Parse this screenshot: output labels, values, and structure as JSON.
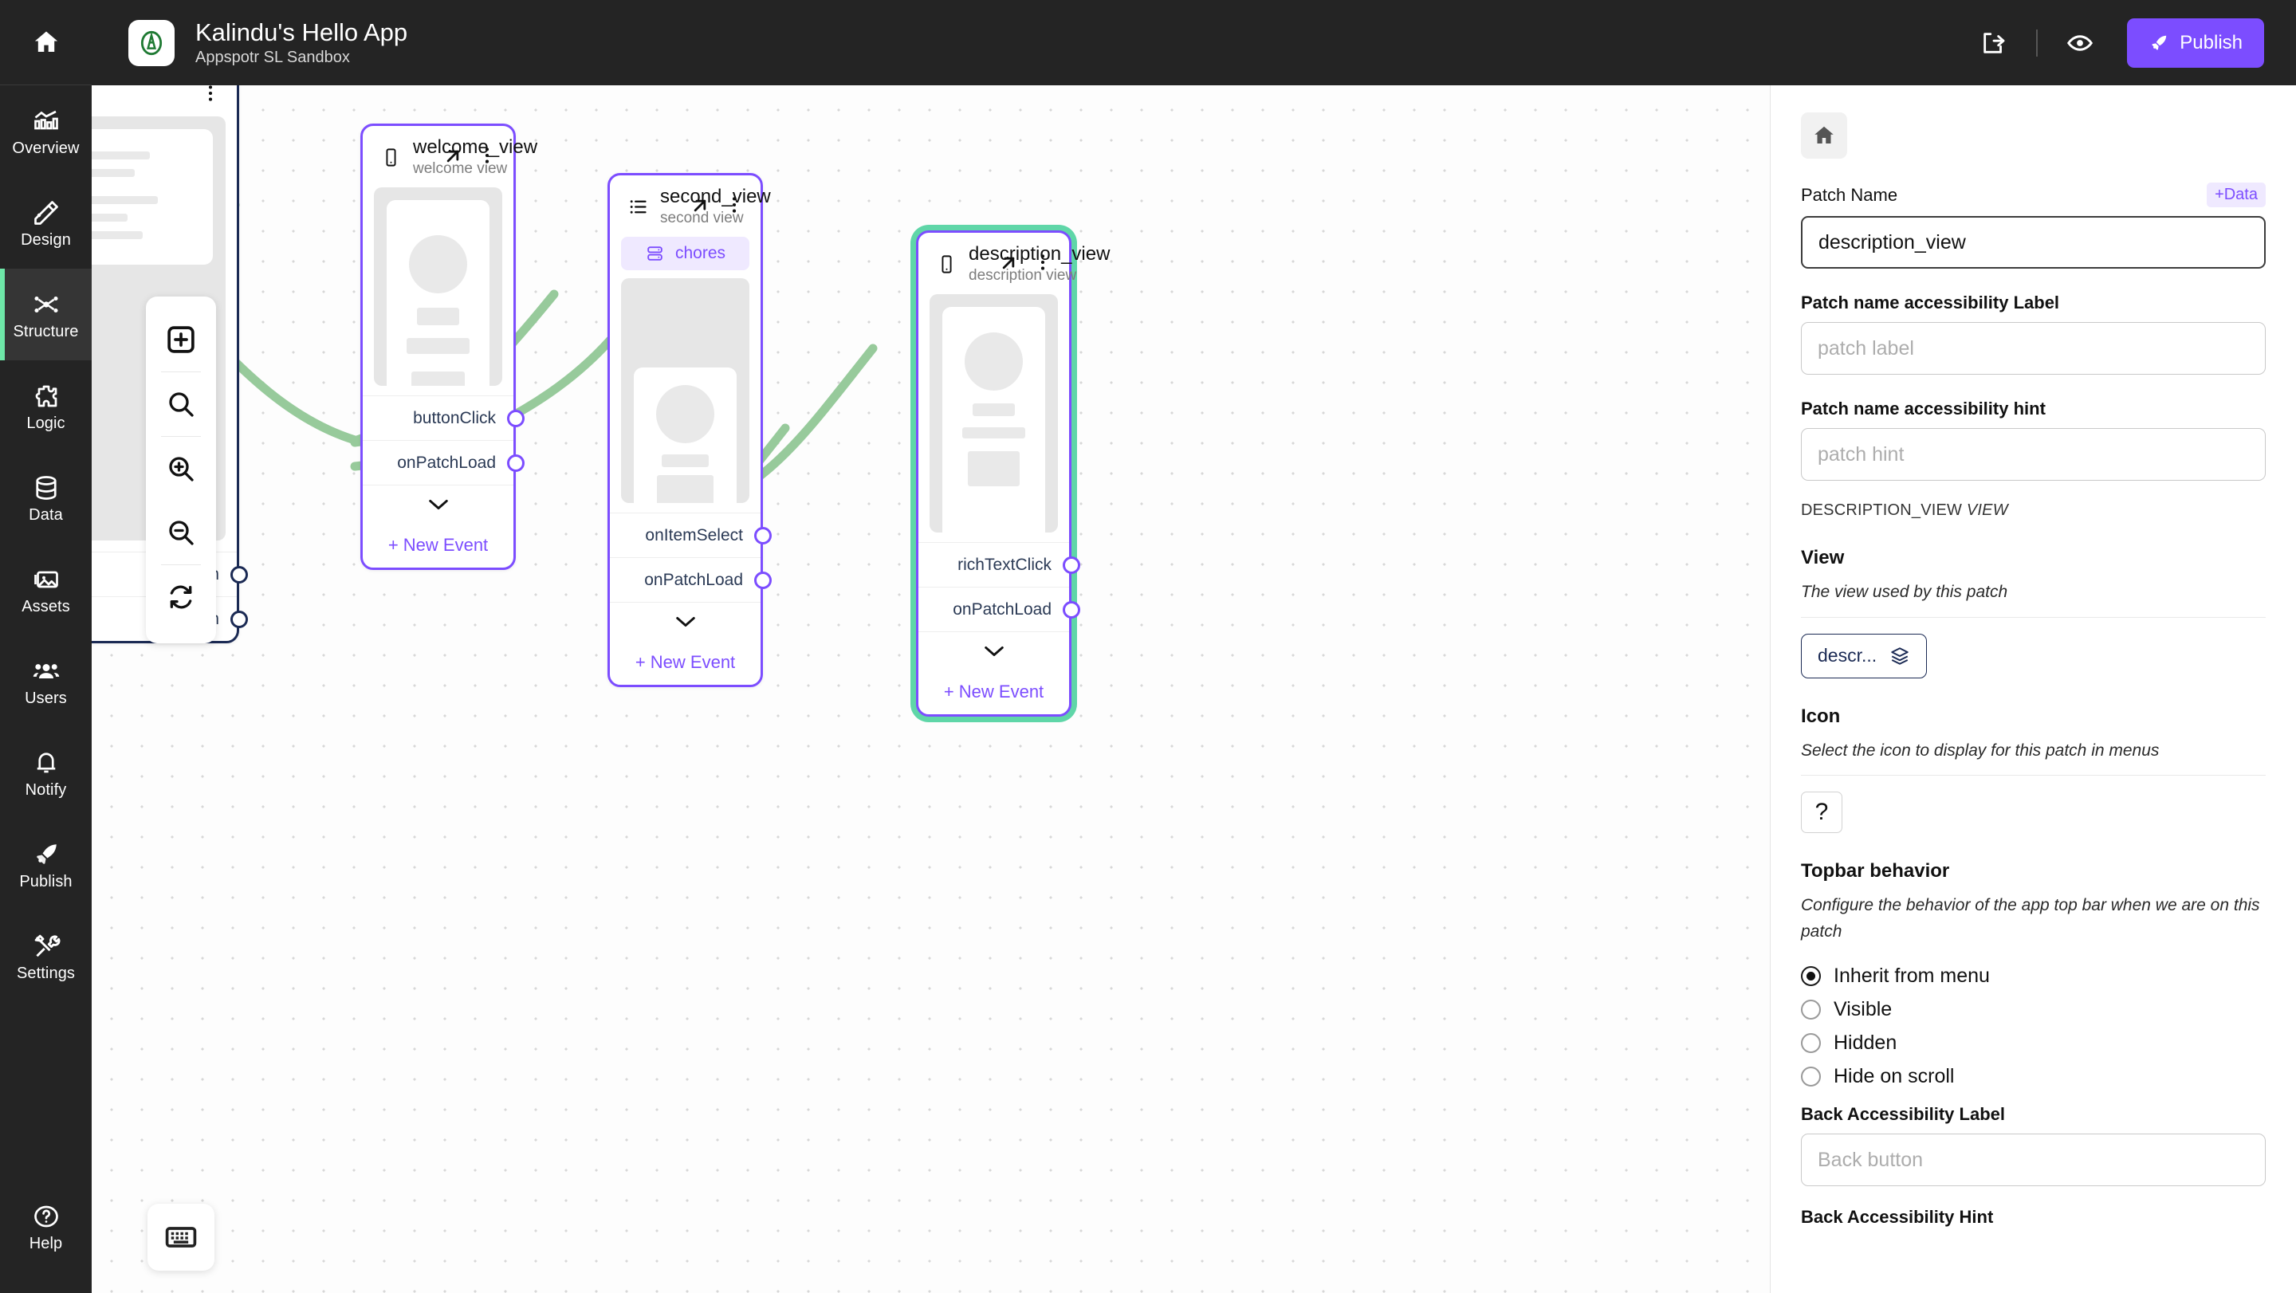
{
  "header": {
    "app_title": "Kalindu's Hello App",
    "workspace": "Appspotr SL Sandbox",
    "publish_label": "Publish",
    "share_icon": "share-icon",
    "preview_icon": "eye-icon",
    "rocket_icon": "rocket-icon",
    "brand_accent": "#7c4dff"
  },
  "sidebar": {
    "home_icon": "home-icon",
    "items": [
      {
        "label": "Overview",
        "icon": "chart-icon",
        "active": false
      },
      {
        "label": "Design",
        "icon": "pencil-ruler-icon",
        "active": false
      },
      {
        "label": "Structure",
        "icon": "structure-nodes-icon",
        "active": true
      },
      {
        "label": "Logic",
        "icon": "puzzle-icon",
        "active": false
      },
      {
        "label": "Data",
        "icon": "database-icon",
        "active": false
      },
      {
        "label": "Assets",
        "icon": "image-icon",
        "active": false
      },
      {
        "label": "Users",
        "icon": "users-icon",
        "active": false
      },
      {
        "label": "Notify",
        "icon": "bell-icon",
        "active": false
      },
      {
        "label": "Publish",
        "icon": "rocket-icon",
        "active": false
      },
      {
        "label": "Settings",
        "icon": "tools-icon",
        "active": false
      }
    ],
    "help": {
      "label": "Help",
      "icon": "question-circle-icon"
    },
    "active_accent": "#6ee7a8"
  },
  "canvas": {
    "toolbar": [
      {
        "name": "add-node-button",
        "icon": "boxed-plus-icon"
      },
      {
        "name": "search-button",
        "icon": "search-icon"
      },
      {
        "name": "zoom-in-button",
        "icon": "zoom-in-icon"
      },
      {
        "name": "zoom-out-button",
        "icon": "zoom-out-icon"
      },
      {
        "name": "reset-view-button",
        "icon": "refresh-icon"
      }
    ],
    "keyboard_button_icon": "keyboard-icon",
    "connection_color": "#97ca9b",
    "nodes": [
      {
        "id": "offscreen_view",
        "title": "",
        "subtitle": "",
        "type_icon": "",
        "border_color": "#1b2a54",
        "selected": false,
        "events": [
          {
            "label": "m",
            "port": true
          },
          {
            "label": "m",
            "port": true
          }
        ]
      },
      {
        "id": "welcome_view",
        "title": "welcome_view",
        "subtitle": "welcome view",
        "type_icon": "phone-icon",
        "border_color": "#7c4dff",
        "selected": false,
        "badge": null,
        "events": [
          {
            "label": "buttonClick",
            "port": true
          },
          {
            "label": "onPatchLoad",
            "port": true
          }
        ],
        "new_event_label": "+ New Event"
      },
      {
        "id": "second_view",
        "title": "second_view",
        "subtitle": "second view",
        "type_icon": "list-icon",
        "border_color": "#7c4dff",
        "selected": false,
        "badge": {
          "label": "chores",
          "icon": "data-source-icon"
        },
        "events": [
          {
            "label": "onItemSelect",
            "port": true
          },
          {
            "label": "onPatchLoad",
            "port": true
          }
        ],
        "new_event_label": "+ New Event"
      },
      {
        "id": "description_view",
        "title": "description_view",
        "subtitle": "description view",
        "type_icon": "phone-icon",
        "border_color": "#7c4dff",
        "selected": true,
        "selection_color": "#5fd6a8",
        "badge": null,
        "events": [
          {
            "label": "richTextClick",
            "port": true
          },
          {
            "label": "onPatchLoad",
            "port": true
          }
        ],
        "new_event_label": "+ New Event"
      }
    ]
  },
  "panel": {
    "header_icon": "home-icon",
    "patch_name": {
      "label": "Patch Name",
      "data_chip": "+Data",
      "value": "description_view"
    },
    "accessibility_label": {
      "label": "Patch name accessibility Label",
      "value": "",
      "placeholder": "patch label"
    },
    "accessibility_hint": {
      "label": "Patch name accessibility hint",
      "value": "",
      "placeholder": "patch hint"
    },
    "meta_line_name": "DESCRIPTION_VIEW",
    "meta_line_suffix": "VIEW",
    "view_section": {
      "title": "View",
      "description": "The view used by this patch",
      "chip_label": "descr...",
      "chip_icon": "layers-icon"
    },
    "icon_section": {
      "title": "Icon",
      "description": "Select the icon to display for this patch in menus",
      "current_icon": "?"
    },
    "topbar_section": {
      "title": "Topbar behavior",
      "description": "Configure the behavior of the app top bar when we are on this patch",
      "options": [
        {
          "label": "Inherit from menu",
          "selected": true
        },
        {
          "label": "Visible",
          "selected": false
        },
        {
          "label": "Hidden",
          "selected": false
        },
        {
          "label": "Hide on scroll",
          "selected": false
        }
      ]
    },
    "back_label": {
      "label": "Back Accessibility Label",
      "value": "",
      "placeholder": "Back button"
    },
    "back_hint": {
      "label": "Back Accessibility Hint"
    }
  }
}
